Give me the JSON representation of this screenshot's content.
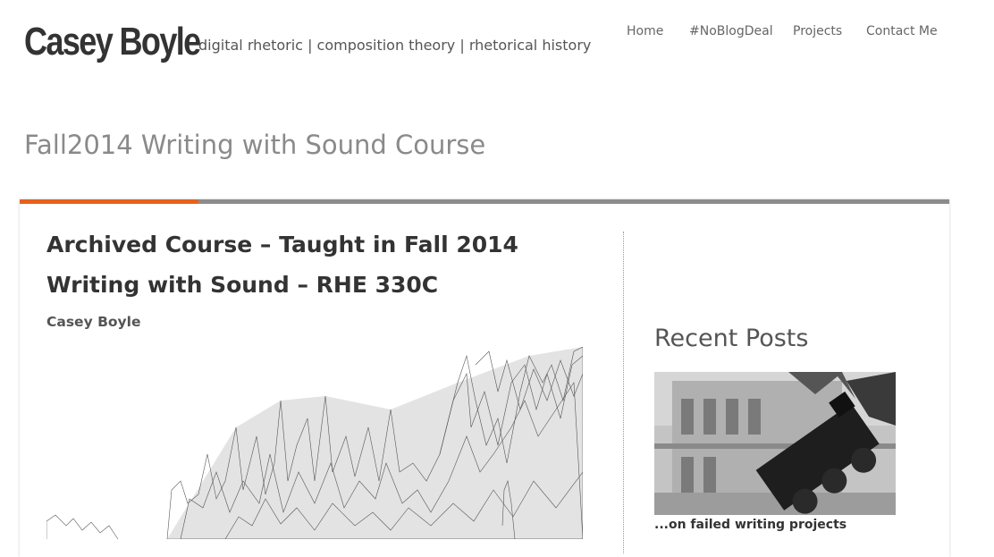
{
  "site": {
    "title": "Casey Boyle",
    "tagline": "digital rhetoric | composition theory | rhetorical history"
  },
  "nav": {
    "items": [
      {
        "label": "Home"
      },
      {
        "label": "#NoBlogDeal"
      },
      {
        "label": "Projects"
      },
      {
        "label": "Contact Me"
      }
    ]
  },
  "page": {
    "title": "Fall2014 Writing with Sound Course"
  },
  "post": {
    "heading_line1": "Archived Course – Taught in Fall 2014",
    "heading_line2": "Writing with Sound – RHE 330C",
    "author": "Casey Boyle",
    "image_icon": "sound-waveform-art-image"
  },
  "sidebar": {
    "widget_title": "Recent Posts",
    "recent_posts": [
      {
        "caption": "...on failed writing projects",
        "image_icon": "train-wreck-photo"
      }
    ]
  },
  "colors": {
    "accent": "#e8601c",
    "bar": "#8c8c8c",
    "title_grey": "#8a8a8a"
  }
}
